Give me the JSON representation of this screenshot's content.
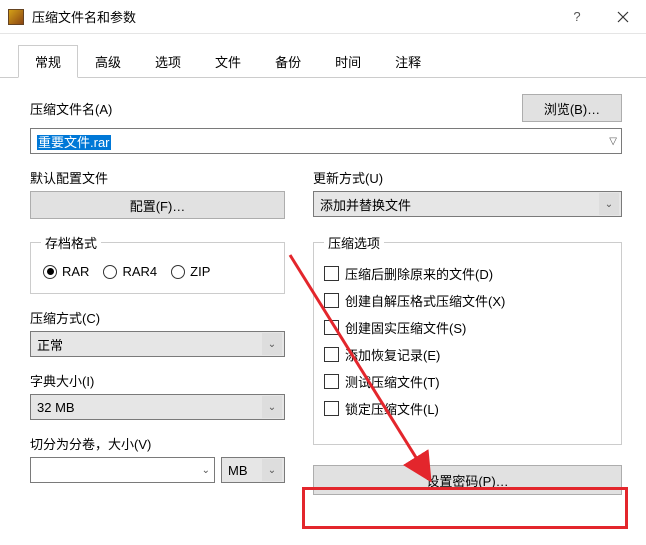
{
  "window": {
    "title": "压缩文件名和参数"
  },
  "tabs": [
    "常规",
    "高级",
    "选项",
    "文件",
    "备份",
    "时间",
    "注释"
  ],
  "top": {
    "archiveNameLabel": "压缩文件名(A)",
    "archiveNameValue": "重要文件.rar",
    "browseLabel": "浏览(B)…",
    "defaultProfileLabel": "默认配置文件",
    "configureLabel": "配置(F)…",
    "updateModeLabel": "更新方式(U)",
    "updateModeValue": "添加并替换文件"
  },
  "archiveFormat": {
    "legend": "存档格式",
    "options": [
      "RAR",
      "RAR4",
      "ZIP"
    ],
    "selected": "RAR"
  },
  "compressionMethod": {
    "label": "压缩方式(C)",
    "value": "正常"
  },
  "dictionarySize": {
    "label": "字典大小(I)",
    "value": "32 MB"
  },
  "splitVolume": {
    "label": "切分为分卷，大小(V)",
    "value": "",
    "unit": "MB"
  },
  "compressionOptions": {
    "legend": "压缩选项",
    "items": [
      "压缩后删除原来的文件(D)",
      "创建自解压格式压缩文件(X)",
      "创建固实压缩文件(S)",
      "添加恢复记录(E)",
      "测试压缩文件(T)",
      "锁定压缩文件(L)"
    ]
  },
  "setPassword": "设置密码(P)…"
}
